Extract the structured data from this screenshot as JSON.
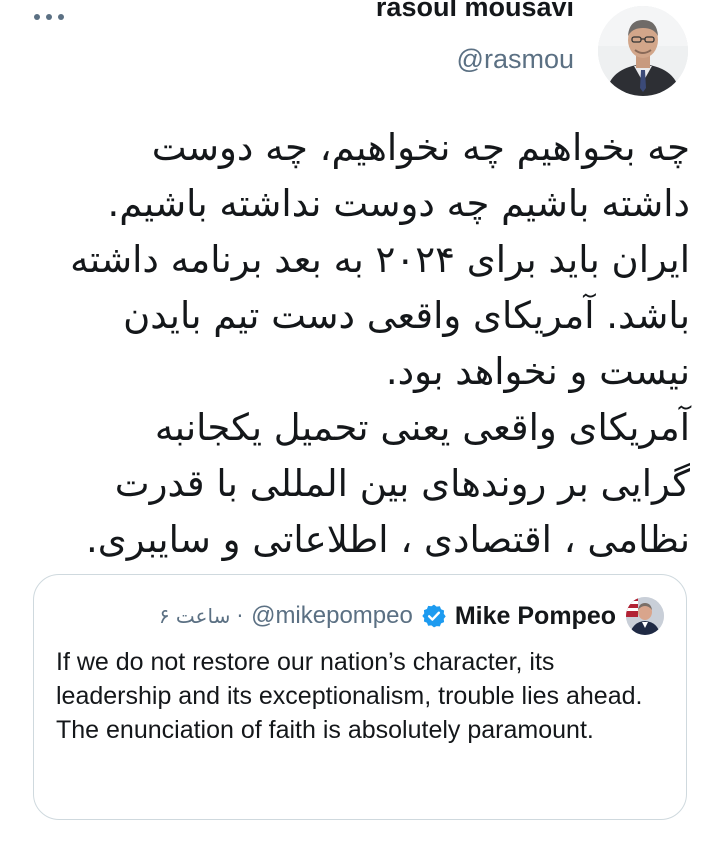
{
  "author": {
    "display_name": "rasoul mousavi",
    "handle": "@rasmou"
  },
  "tweet": {
    "lines": [
      "چه بخواهیم  چه نخواهیم،  چه دوست",
      "داشته باشیم چه دوست نداشته باشیم.",
      "ایران باید برای ۲۰۲۴ به بعد برنامه داشته",
      "باشد. آمریکای واقعی دست تیم بایدن",
      "نیست و نخواهد بود.",
      "آمریکای واقعی یعنی تحمیل یکجانبه",
      "گرایی بر  روندهای بین المللی با قدرت",
      "نظامی ، اقتصادی ، اطلاعاتی و سایبری."
    ]
  },
  "quoted_tweet": {
    "name": "Mike Pompeo",
    "handle": "@mikepompeo",
    "time": "۶ ساعت ·",
    "text": "If we do not restore our nation’s character, its leadership and its exceptionalism, trouble lies ahead. The enunciation of faith is absolutely paramount."
  },
  "icons": {
    "more": "more-horizontal-icon",
    "verified": "verified-badge-icon"
  },
  "colors": {
    "text": "#14171a",
    "secondary": "#5b7083",
    "verified": "#1d9bf0",
    "border": "#cfd9de"
  }
}
